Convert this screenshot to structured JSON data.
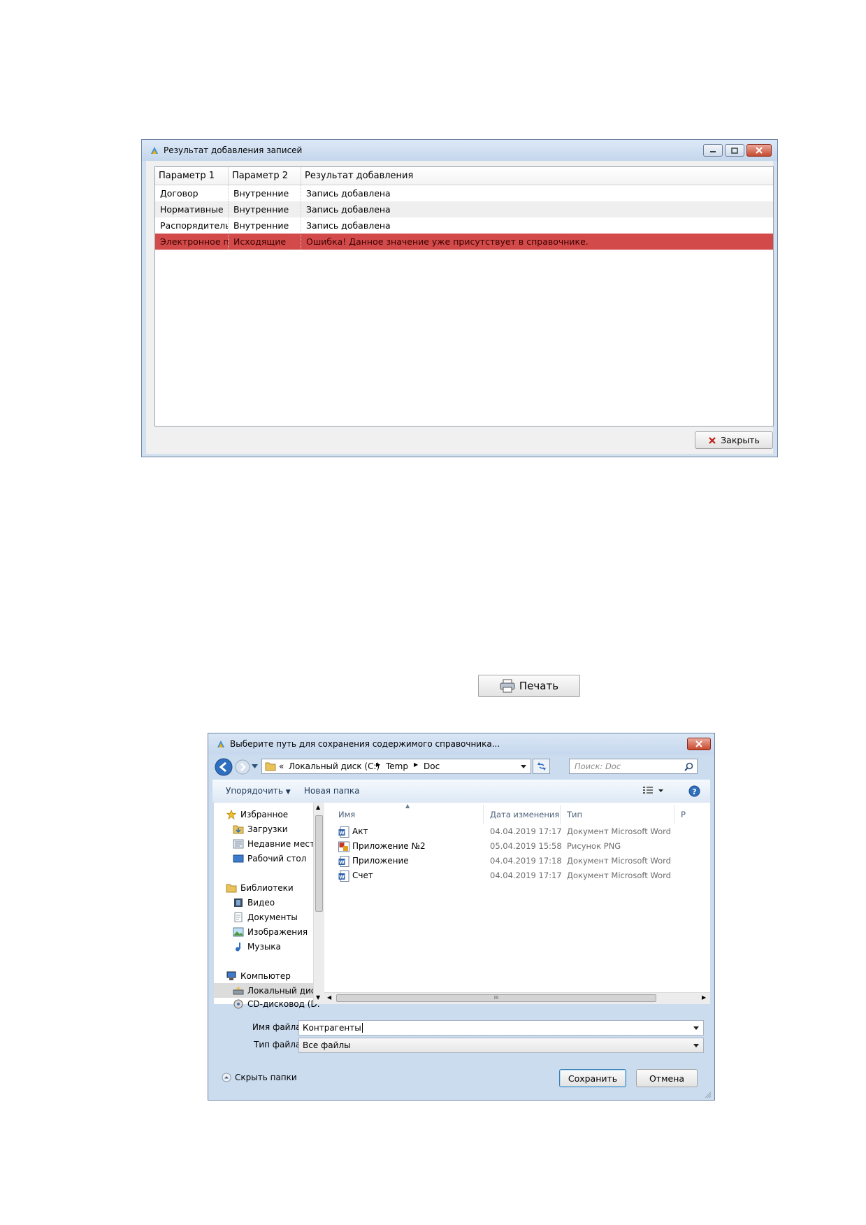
{
  "result_window": {
    "title": "Результат добавления записей",
    "columns": [
      "Параметр 1",
      "Параметр 2",
      "Результат добавления"
    ],
    "rows": [
      {
        "p1": "Договор",
        "p2": "Внутренние",
        "result": "Запись добавлена"
      },
      {
        "p1": "Нормативные",
        "p2": "Внутренние",
        "result": "Запись добавлена"
      },
      {
        "p1": "Распорядительн",
        "p2": "Внутренние",
        "result": "Запись добавлена"
      },
      {
        "p1": "Электронное пи",
        "p2": "Исходящие",
        "result": "Ошибка! Данное значение уже присутствует в справочнике."
      }
    ],
    "close_button": "Закрыть",
    "error_color": "#d34a4a"
  },
  "print_button": {
    "label": "Печать"
  },
  "save_dialog": {
    "title": "Выберите путь для сохранения содержимого справочника...",
    "address": {
      "prefix": "«",
      "crumbs": [
        "Локальный диск (C:)",
        "Temp",
        "Doc"
      ]
    },
    "search_placeholder": "Поиск: Doc",
    "toolbar": {
      "organize": "Упорядочить",
      "new_folder": "Новая папка"
    },
    "nav": {
      "favorites": "Избранное",
      "downloads": "Загрузки",
      "recent": "Недавние места",
      "desktop": "Рабочий стол",
      "libraries": "Библиотеки",
      "video": "Видео",
      "documents": "Документы",
      "images": "Изображения",
      "music": "Музыка",
      "computer": "Компьютер",
      "local_disk": "Локальный диск",
      "cd_drive": "CD-дисковод (D:"
    },
    "file_headers": {
      "name": "Имя",
      "date": "Дата изменения",
      "type": "Тип",
      "size": "Р"
    },
    "files": [
      {
        "name": "Акт",
        "date": "04.04.2019 17:17",
        "type": "Документ Microsoft Word"
      },
      {
        "name": "Приложение №2",
        "date": "05.04.2019 15:58",
        "type": "Рисунок PNG"
      },
      {
        "name": "Приложение",
        "date": "04.04.2019 17:18",
        "type": "Документ Microsoft Word"
      },
      {
        "name": "Счет",
        "date": "04.04.2019 17:17",
        "type": "Документ Microsoft Word"
      }
    ],
    "hscroll_grip": "III",
    "filename_label": "Имя файла:",
    "filename_value": "Контрагенты",
    "filetype_label": "Тип файла:",
    "filetype_value": "Все файлы",
    "hide_folders": "Скрыть папки",
    "save_button": "Сохранить",
    "cancel_button": "Отмена"
  }
}
